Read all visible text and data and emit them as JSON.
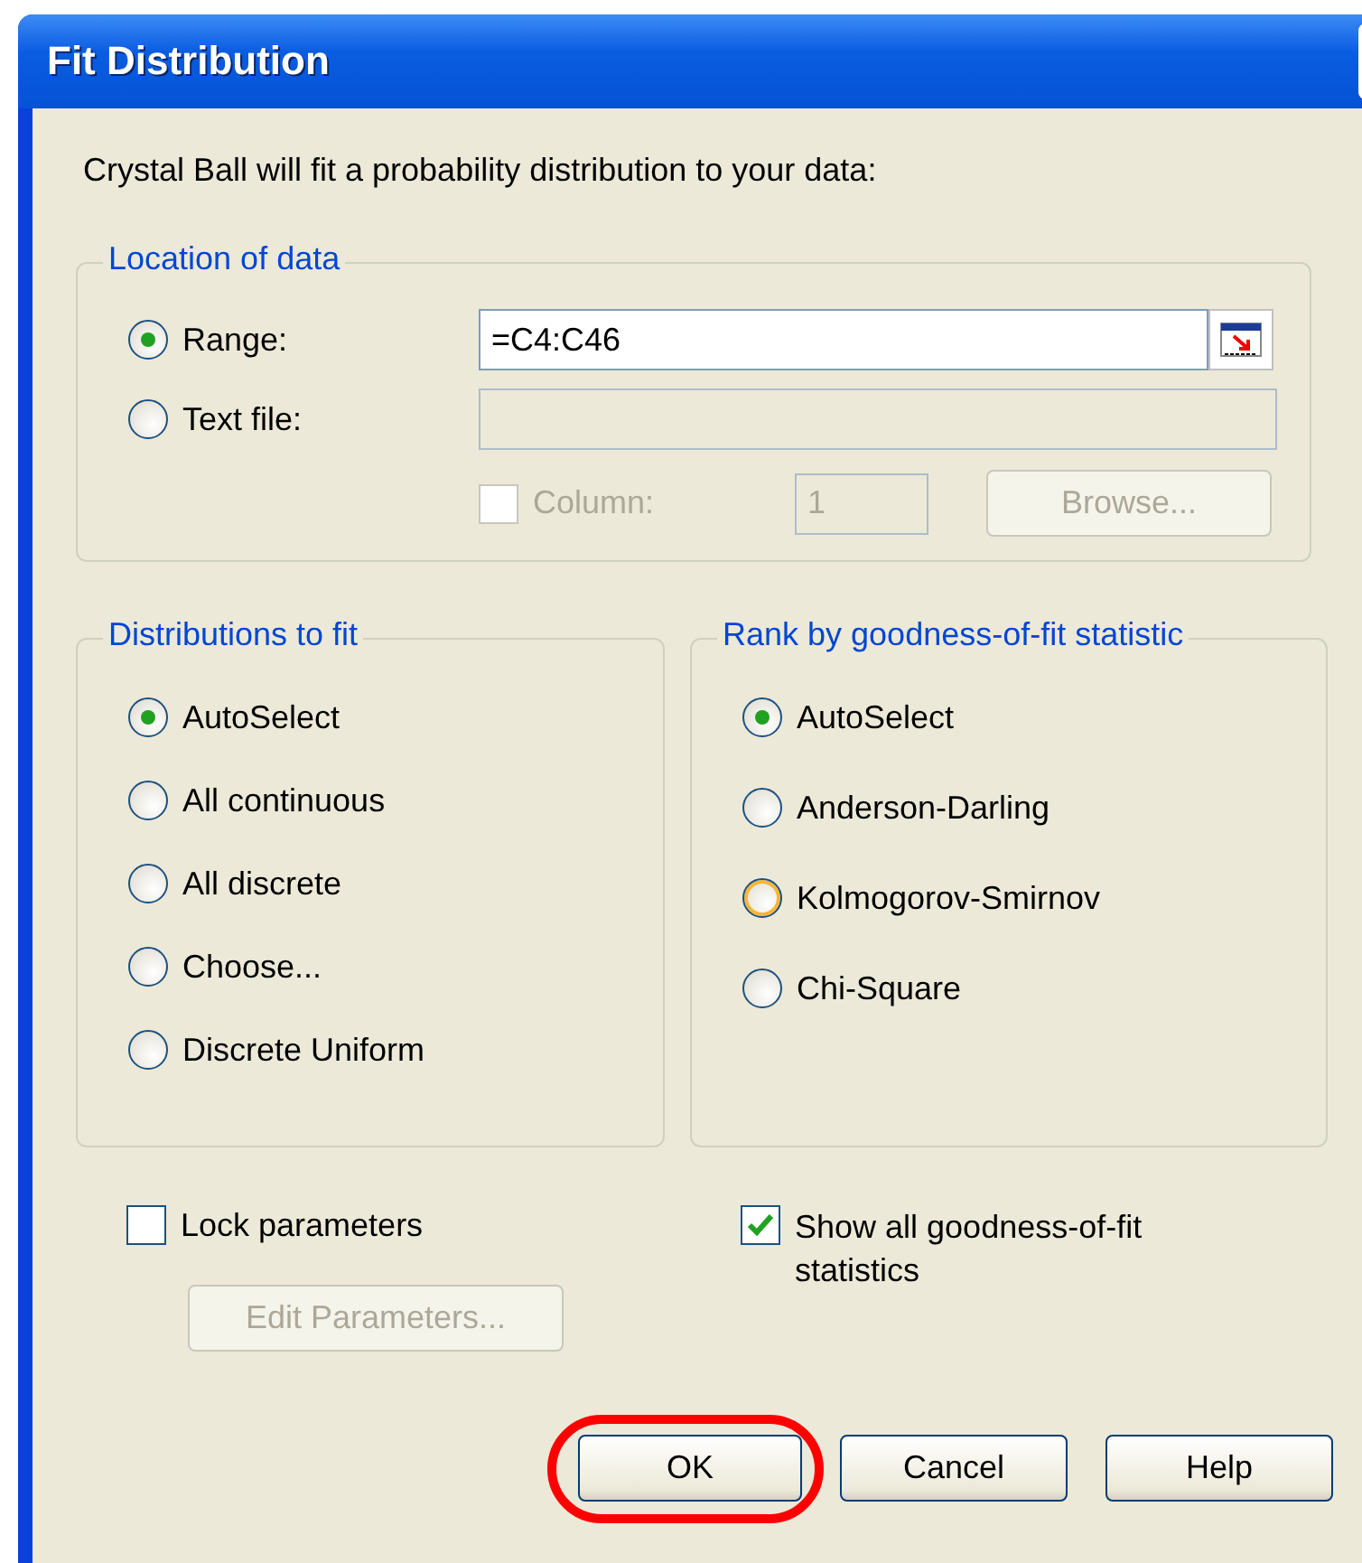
{
  "window": {
    "title": "Fit Distribution"
  },
  "intro": "Crystal Ball will fit a probability distribution to your data:",
  "location_of_data": {
    "title": "Location of data",
    "options": [
      {
        "label": "Range:",
        "selected": true,
        "hovered": false,
        "field": {
          "value": "=C4:C46",
          "disabled": false
        }
      },
      {
        "label": "Text file:",
        "selected": false,
        "hovered": false,
        "field": {
          "disabled": true
        }
      }
    ],
    "column": {
      "label": "Column:",
      "checked": false,
      "disabled": true,
      "value": "1"
    },
    "browse": {
      "label": "Browse...",
      "disabled": true
    }
  },
  "distributions_to_fit": {
    "title": "Distributions to fit",
    "options": [
      {
        "label": "AutoSelect",
        "selected": true,
        "hovered": false
      },
      {
        "label": "All continuous",
        "selected": false,
        "hovered": false
      },
      {
        "label": "All discrete",
        "selected": false,
        "hovered": false
      },
      {
        "label": "Choose...",
        "selected": false,
        "hovered": false
      },
      {
        "label": "Discrete Uniform",
        "selected": false,
        "hovered": false
      }
    ]
  },
  "rank_by": {
    "title": "Rank by goodness-of-fit statistic",
    "options": [
      {
        "label": "AutoSelect",
        "selected": true,
        "hovered": false
      },
      {
        "label": "Anderson-Darling",
        "selected": false,
        "hovered": false
      },
      {
        "label": "Kolmogorov-Smirnov",
        "selected": false,
        "hovered": true
      },
      {
        "label": "Chi-Square",
        "selected": false,
        "hovered": false
      }
    ]
  },
  "lock_parameters": {
    "label": "Lock parameters",
    "checked": false,
    "disabled": false
  },
  "edit_parameters": {
    "label": "Edit Parameters...",
    "disabled": true
  },
  "show_all_statistics": {
    "label": "Show all goodness-of-fit statistics",
    "checked": true,
    "disabled": false
  },
  "buttons": [
    {
      "label": "OK",
      "circled": true
    },
    {
      "label": "Cancel",
      "circled": false
    },
    {
      "label": "Help",
      "circled": false
    }
  ]
}
